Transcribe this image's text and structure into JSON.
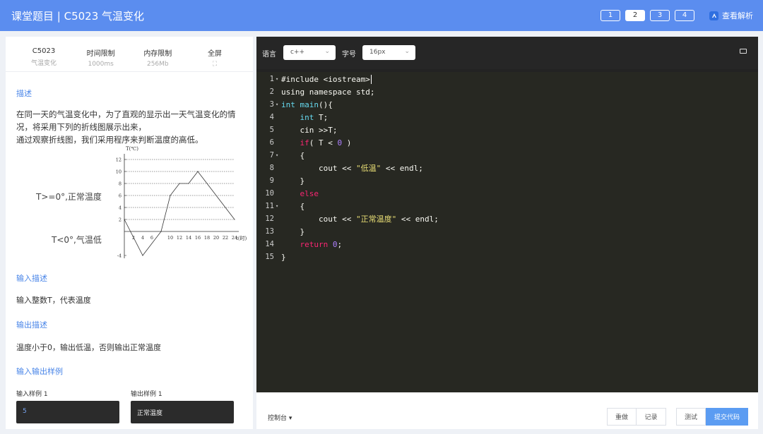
{
  "header": {
    "title": "课堂题目 | C5023 气温变化",
    "pages": [
      "1",
      "2",
      "3",
      "4"
    ],
    "active_page": "2",
    "analysis_label": "查看解析"
  },
  "problem_info": {
    "columns": [
      {
        "key": "C5023",
        "value": "气温变化"
      },
      {
        "key": "时间限制",
        "value": "1000ms"
      },
      {
        "key": "内存限制",
        "value": "256Mb"
      },
      {
        "key": "全屏",
        "value": "⛶"
      }
    ]
  },
  "description": {
    "heading": "描述",
    "lines": [
      "在同一天的气温变化中，为了直观的显示出一天气温变化的情",
      "况，将采用下列的折线图展示出来，",
      "通过观察折线图，我们采用程序来判断温度的高低。"
    ]
  },
  "figure": {
    "label_high": "T>=0°,正常温度",
    "label_low": "T<0°,气温低",
    "y_axis_label": "T(℃)",
    "x_axis_label": "t(时)",
    "y_ticks": [
      "12",
      "10",
      "8",
      "6",
      "4",
      "2",
      "-4"
    ],
    "x_ticks": [
      "2",
      "4",
      "6",
      "10",
      "12",
      "14",
      "16",
      "18",
      "20",
      "22",
      "24"
    ]
  },
  "chart_data": {
    "type": "line",
    "xlabel": "t(时)",
    "ylabel": "T(℃)",
    "xlim": [
      0,
      24
    ],
    "ylim": [
      -4,
      12
    ],
    "x": [
      0,
      4,
      8,
      10,
      12,
      14,
      16,
      24
    ],
    "values": [
      2,
      -4,
      0,
      6,
      8,
      8,
      10,
      2
    ]
  },
  "input_desc": {
    "heading": "输入描述",
    "text": "输入整数T，代表温度"
  },
  "output_desc": {
    "heading": "输出描述",
    "text": "温度小于0，输出低温，否则输出正常温度"
  },
  "samples": {
    "heading": "输入输出样例",
    "input_label": "输入样例 1",
    "input_value": "5",
    "output_label": "输出样例 1",
    "output_value": "正常温度"
  },
  "toolbar": {
    "language_label": "语言",
    "language_value": "c++",
    "fontsize_label": "字号",
    "fontsize_value": "16px"
  },
  "code_lines": [
    {
      "n": "1",
      "fold": "▾",
      "text": "#include <iostream>"
    },
    {
      "n": "2",
      "fold": "",
      "text": "using namespace std;"
    },
    {
      "n": "3",
      "fold": "▾",
      "text": "int main(){"
    },
    {
      "n": "4",
      "fold": "",
      "text": "    int T;"
    },
    {
      "n": "5",
      "fold": "",
      "text": "    cin >>T;"
    },
    {
      "n": "6",
      "fold": "",
      "text": "    if( T < 0 )"
    },
    {
      "n": "7",
      "fold": "▾",
      "text": "    {"
    },
    {
      "n": "8",
      "fold": "",
      "text": "        cout << \"低温\" << endl;"
    },
    {
      "n": "9",
      "fold": "",
      "text": "    }"
    },
    {
      "n": "10",
      "fold": "",
      "text": "    else"
    },
    {
      "n": "11",
      "fold": "▾",
      "text": "    {"
    },
    {
      "n": "12",
      "fold": "",
      "text": "        cout << \"正常温度\" << endl;"
    },
    {
      "n": "13",
      "fold": "",
      "text": "    }"
    },
    {
      "n": "14",
      "fold": "",
      "text": "    return 0;"
    },
    {
      "n": "15",
      "fold": "",
      "text": "}"
    }
  ],
  "bottom": {
    "console_label": "控制台 ▾",
    "redo_label": "重做",
    "record_label": "记录",
    "test_label": "测试",
    "submit_label": "提交代码"
  }
}
